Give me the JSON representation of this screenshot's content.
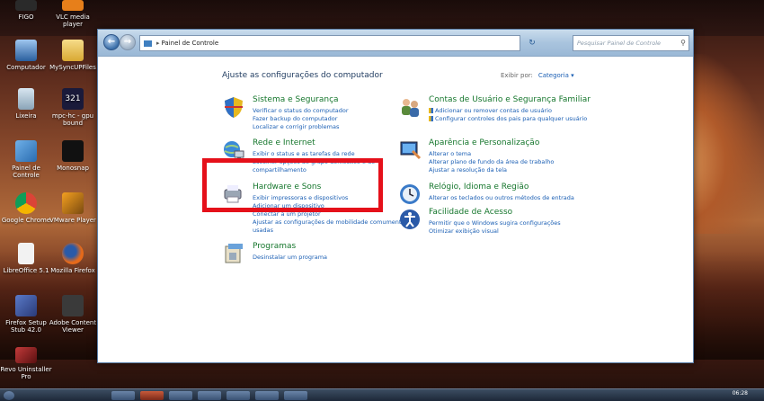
{
  "desktop": {
    "icons": [
      {
        "label": "FIGO"
      },
      {
        "label": "VLC media player"
      },
      {
        "label": "Computador"
      },
      {
        "label": "MySyncUPFiles"
      },
      {
        "label": "Lixeira"
      },
      {
        "label": "mpc-hc - gpu bound"
      },
      {
        "label": "Painel de Controle"
      },
      {
        "label": "Monosnap"
      },
      {
        "label": "Google Chrome"
      },
      {
        "label": "VMware Player"
      },
      {
        "label": "LibreOffice 5.1"
      },
      {
        "label": "Mozilla Firefox"
      },
      {
        "label": "Firefox Setup Stub 42.0"
      },
      {
        "label": "Adobe Content Viewer"
      },
      {
        "label": "Revo Uninstaller Pro"
      }
    ]
  },
  "window": {
    "address": {
      "path_item": "Painel de Controle"
    },
    "search": {
      "placeholder": "Pesquisar Painel de Controle"
    },
    "heading": "Ajuste as configurações do computador",
    "view_by": {
      "label": "Exibir por:",
      "value": "Categoria"
    },
    "categories_left": [
      {
        "title": "Sistema e Segurança",
        "icon": "security-icon",
        "links": [
          "Verificar o status do computador",
          "Fazer backup do computador",
          "Localizar e corrigir problemas"
        ]
      },
      {
        "title": "Rede e Internet",
        "icon": "network-icon",
        "links": [
          "Exibir o status e as tarefas da rede",
          "Escolher opções de grupo doméstico e de compartilhamento"
        ]
      },
      {
        "title": "Hardware e Sons",
        "icon": "hardware-icon",
        "links": [
          "Exibir impressoras e dispositivos",
          "Adicionar um dispositivo",
          "Conectar a um projetor",
          "Ajustar as configurações de mobilidade comumente usadas"
        ]
      },
      {
        "title": "Programas",
        "icon": "programs-icon",
        "links": [
          "Desinstalar um programa"
        ]
      }
    ],
    "categories_right": [
      {
        "title": "Contas de Usuário e Segurança Familiar",
        "icon": "users-icon",
        "links": [
          "Adicionar ou remover contas de usuário",
          "Configurar controles dos pais para qualquer usuário"
        ]
      },
      {
        "title": "Aparência e Personalização",
        "icon": "appearance-icon",
        "links": [
          "Alterar o tema",
          "Alterar plano de fundo da área de trabalho",
          "Ajustar a resolução da tela"
        ]
      },
      {
        "title": "Relógio, Idioma e Região",
        "icon": "clock-globe-icon",
        "links": [
          "Alterar os teclados ou outros métodos de entrada"
        ]
      },
      {
        "title": "Facilidade de Acesso",
        "icon": "accessibility-icon",
        "links": [
          "Permitir que o Windows sugira configurações",
          "Otimizar exibição visual"
        ]
      }
    ]
  },
  "taskbar": {
    "clock": "06:28"
  }
}
